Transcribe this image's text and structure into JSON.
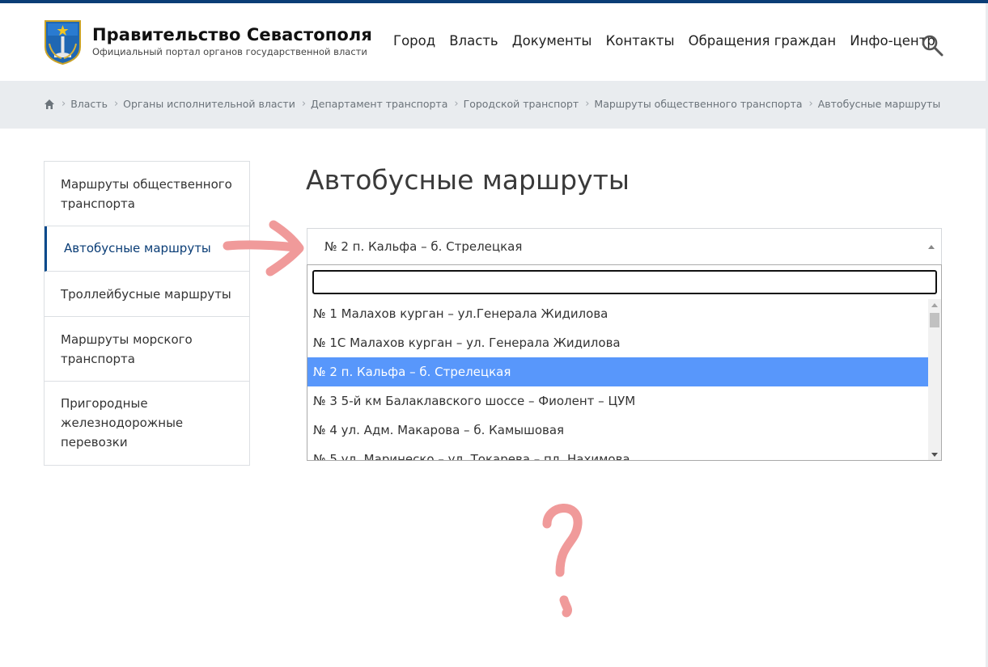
{
  "colors": {
    "brand": "#0a3d76",
    "highlight": "#5897fb",
    "annotation": "#f09a9a",
    "breadcrumb_bg": "#e9ecef"
  },
  "header": {
    "title": "Правительство Севастополя",
    "subtitle": "Официальный портал органов государственной власти",
    "logo_icon": "sevastopol-coat-of-arms",
    "nav": [
      "Город",
      "Власть",
      "Документы",
      "Контакты",
      "Обращения граждан",
      "Инфо-центр"
    ],
    "search_icon": "search-icon"
  },
  "breadcrumbs": {
    "home_icon": "home-icon",
    "separator": "›",
    "items": [
      "Власть",
      "Органы исполнительной власти",
      "Департамент транспорта",
      "Городской транспорт",
      "Маршруты общественного транспорта",
      "Автобусные маршруты"
    ]
  },
  "sidebar": {
    "items": [
      {
        "label": "Маршруты общественного транспорта",
        "active": false
      },
      {
        "label": "Автобусные маршруты",
        "active": true
      },
      {
        "label": "Троллейбусные маршруты",
        "active": false
      },
      {
        "label": "Маршруты морского транспорта",
        "active": false
      },
      {
        "label": "Пригородные железнодорожные перевозки",
        "active": false
      }
    ]
  },
  "main": {
    "title": "Автобусные маршруты",
    "select": {
      "value": "№ 2 п. Кальфа – б. Стрелецкая",
      "search_value": "",
      "options": [
        "№ 1 Малахов курган – ул.Генерала Жидилова",
        "№ 1С Малахов курган – ул. Генерала Жидилова",
        "№ 2 п. Кальфа – б. Стрелецкая",
        "№ 3 5-й км Балаклавского шоссе – Фиолент – ЦУМ",
        "№ 4 ул. Адм. Макарова – б. Камышовая",
        "№ 5 ул. Маринеско – ул. Токарева – пл. Нахимова"
      ],
      "highlighted_index": 2
    }
  },
  "annotations": {
    "arrow_icon": "hand-drawn-arrow",
    "question_icon": "hand-drawn-question-mark"
  }
}
